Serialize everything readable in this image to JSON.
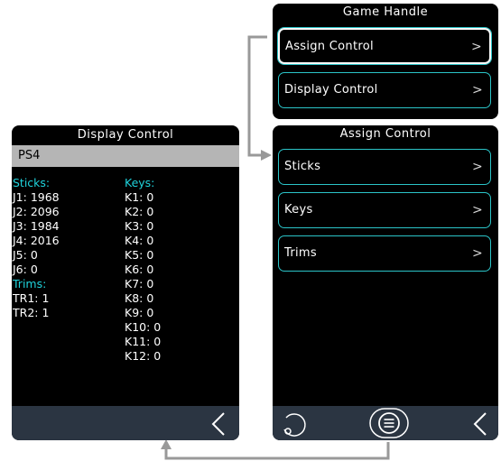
{
  "game_handle": {
    "title": "Game Handle",
    "items": [
      {
        "label": "Assign Control",
        "chevron": ">"
      },
      {
        "label": "Display Control",
        "chevron": ">"
      }
    ]
  },
  "assign_control": {
    "title": "Assign Control",
    "items": [
      {
        "label": "Sticks",
        "chevron": ">"
      },
      {
        "label": "Keys",
        "chevron": ">"
      },
      {
        "label": "Trims",
        "chevron": ">"
      }
    ],
    "footer_icons": [
      "rotate-icon",
      "menu-icon",
      "back-chevron-icon"
    ]
  },
  "display_control": {
    "title": "Display Control",
    "device": "PS4",
    "sticks_header": "Sticks:",
    "sticks": [
      "J1: 1968",
      "J2: 2096",
      "J3: 1984",
      "J4: 2016",
      "J5: 0",
      "J6: 0"
    ],
    "trims_header": "Trims:",
    "trims": [
      "TR1: 1",
      "TR2: 1"
    ],
    "keys_header": "Keys:",
    "keys": [
      "K1: 0",
      "K2: 0",
      "K3: 0",
      "K4: 0",
      "K5: 0",
      "K6: 0",
      "K7: 0",
      "K8: 0",
      "K9: 0",
      "K10: 0",
      "K11: 0",
      "K12: 0"
    ],
    "footer_icons": [
      "back-chevron-icon"
    ]
  },
  "colors": {
    "accent_cyan": "#2bc4c8",
    "header_cyan": "#1fd3dc",
    "footer_bg": "#2b3542",
    "panel_bg": "#000000",
    "connector_gray": "#999999"
  }
}
